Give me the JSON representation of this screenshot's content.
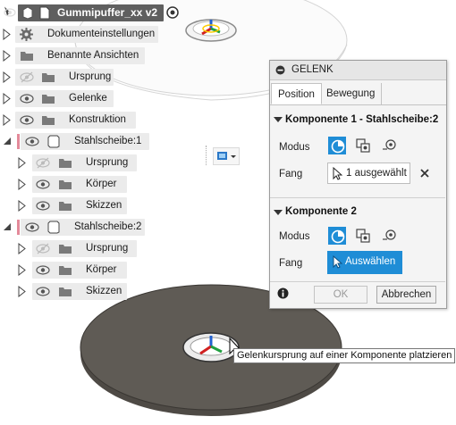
{
  "browser": {
    "root_label": "Gummipuffer_xx v2",
    "items": [
      {
        "label": "Dokumenteinstellungen"
      },
      {
        "label": "Benannte Ansichten"
      },
      {
        "label": "Ursprung"
      },
      {
        "label": "Gelenke"
      },
      {
        "label": "Konstruktion"
      },
      {
        "label": "Stahlscheibe:1"
      },
      {
        "label": "Ursprung"
      },
      {
        "label": "Körper"
      },
      {
        "label": "Skizzen"
      },
      {
        "label": "Stahlscheibe:2"
      },
      {
        "label": "Ursprung"
      },
      {
        "label": "Körper"
      },
      {
        "label": "Skizzen"
      }
    ]
  },
  "dialog": {
    "title": "GELENK",
    "tabs": [
      {
        "label": "Position"
      },
      {
        "label": "Bewegung"
      }
    ],
    "section1": {
      "title": "Komponente 1 - Stahlscheibe:2",
      "mode_label": "Modus",
      "snap_label": "Fang",
      "snap_value": "1 ausgewählt",
      "clear_icon": "x-icon"
    },
    "section2": {
      "title": "Komponente 2",
      "mode_label": "Modus",
      "snap_label": "Fang",
      "select_button": "Auswählen"
    },
    "info_icon": "info-icon",
    "ok_label": "OK",
    "cancel_label": "Abbrechen"
  },
  "tooltip": "Gelenkursprung auf einer Komponente platzieren",
  "colors": {
    "accent": "#1f8dd6",
    "disk_fill": "#5f5b55",
    "root_bar": "#5f5f5f",
    "component_marker": "#e48a9a"
  }
}
